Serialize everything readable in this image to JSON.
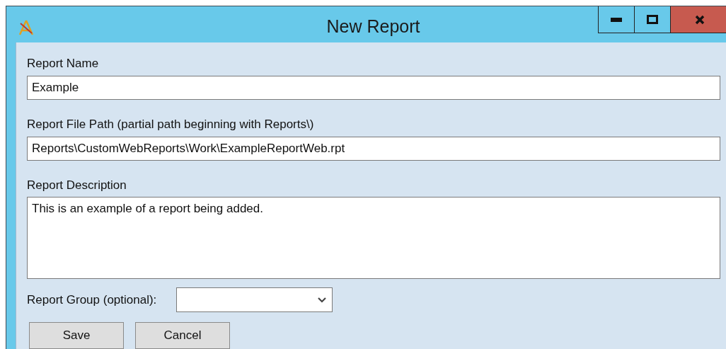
{
  "window": {
    "title": "New Report",
    "controls": [
      {
        "kind": "minimize"
      },
      {
        "kind": "maximize"
      },
      {
        "kind": "close"
      }
    ]
  },
  "fields": [
    {
      "label": "Report Name",
      "value": "Example",
      "kind": "text"
    },
    {
      "label": "Report File Path (partial path beginning with Reports\\)",
      "value": "Reports\\CustomWebReports\\Work\\ExampleReportWeb.rpt",
      "kind": "text"
    },
    {
      "label": "Report Description",
      "value": "This is an example of a report being added.",
      "kind": "multiline"
    }
  ],
  "group": {
    "label": "Report Group (optional):"
  },
  "buttons": [
    "Save",
    "Cancel"
  ]
}
